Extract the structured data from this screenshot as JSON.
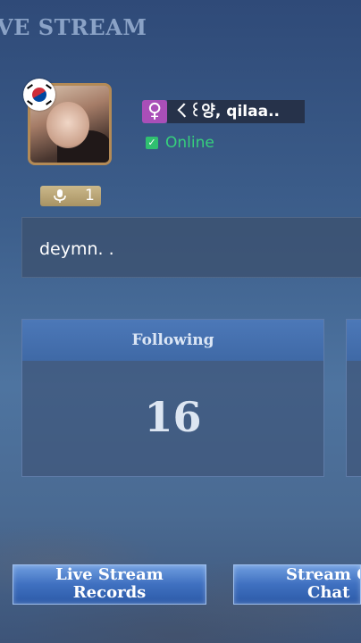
{
  "header": {
    "title": "VE STREAM"
  },
  "profile": {
    "flag_icon": "south-korea-flag-icon",
    "gender_symbol": "♀",
    "username": "ㄑ꒰양, qilaa..",
    "status": "Online",
    "status_color": "#36d07c",
    "mic_count": "1",
    "bio": "deymn. ."
  },
  "stats": [
    {
      "label": "Following",
      "value": "16"
    }
  ],
  "buttons": {
    "live_records_line1": "Live Stream",
    "live_records_line2": "Records",
    "quick_chat_line1": "Stream Qu",
    "quick_chat_line2": "Chat"
  }
}
